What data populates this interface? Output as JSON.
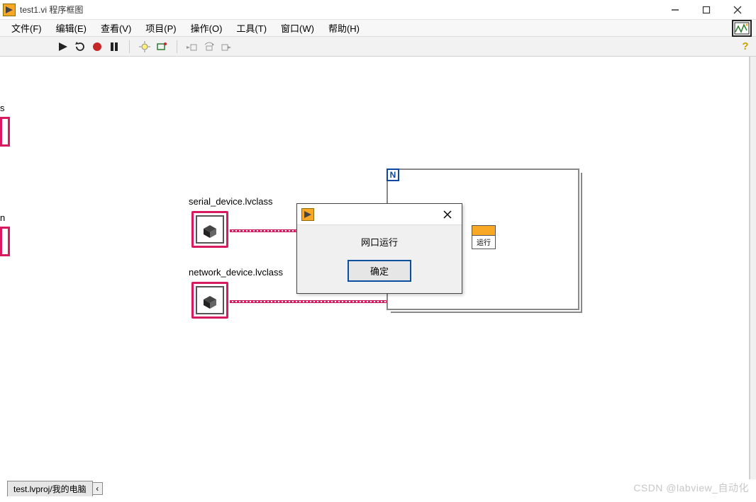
{
  "window": {
    "title": "test1.vi 程序框图",
    "controls": {
      "min": "—",
      "max": "☐",
      "close": "✕"
    }
  },
  "menu": {
    "items": [
      "文件(F)",
      "编辑(E)",
      "查看(V)",
      "项目(P)",
      "操作(O)",
      "工具(T)",
      "窗口(W)",
      "帮助(H)"
    ]
  },
  "toolbar": {
    "icons": [
      "run-arrow-icon",
      "run-cont-icon",
      "abort-icon",
      "pause-icon",
      "highlight-icon",
      "retain-icon",
      "step-into-icon",
      "step-over-icon",
      "step-out-icon"
    ],
    "help_icon": "?"
  },
  "canvas": {
    "label_serial": "serial_device.lvclass",
    "label_network": "network_device.lvclass",
    "label_s": "s",
    "label_n": "n",
    "for_n": "N",
    "vi_label": "运行"
  },
  "dialog": {
    "message": "网口运行",
    "ok": "确定"
  },
  "status": {
    "breadcrumb": "test.lvproj/我的电脑",
    "arrow": "‹"
  },
  "watermark": "CSDN @labview_自动化"
}
